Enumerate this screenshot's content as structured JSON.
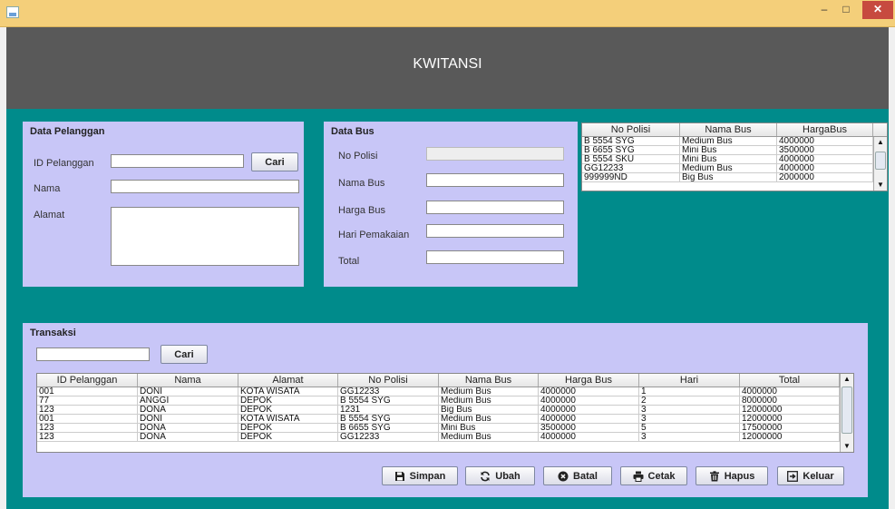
{
  "window": {
    "title": ""
  },
  "header": {
    "title": "KWITANSI"
  },
  "pelanggan": {
    "title": "Data Pelanggan",
    "id_label": "ID Pelanggan",
    "nama_label": "Nama",
    "alamat_label": "Alamat",
    "cari_label": "Cari"
  },
  "bus": {
    "title": "Data Bus",
    "nopol_label": "No Polisi",
    "nama_label": "Nama Bus",
    "harga_label": "Harga Bus",
    "hari_label": "Hari Pemakaian",
    "total_label": "Total"
  },
  "bus_table": {
    "headers": [
      "No Polisi",
      "Nama Bus",
      "HargaBus"
    ],
    "rows": [
      [
        "B 5554 SYG",
        "Medium Bus",
        "4000000"
      ],
      [
        "B 6655 SYG",
        "Mini Bus",
        "3500000"
      ],
      [
        "B 5554 SKU",
        "Mini Bus",
        "4000000"
      ],
      [
        "GG12233",
        "Medium Bus",
        "4000000"
      ],
      [
        "999999ND",
        "Big Bus",
        "2000000"
      ]
    ]
  },
  "transaksi": {
    "title": "Transaksi",
    "cari_label": "Cari",
    "headers": [
      "ID Pelanggan",
      "Nama",
      "Alamat",
      "No Polisi",
      "Nama Bus",
      "Harga Bus",
      "Hari",
      "Total"
    ],
    "rows": [
      [
        "001",
        "DONI",
        "KOTA WISATA",
        "GG12233",
        "Medium Bus",
        "4000000",
        "1",
        "4000000"
      ],
      [
        "77",
        "ANGGI",
        "DEPOK",
        "B 5554 SYG",
        "Medium Bus",
        "4000000",
        "2",
        "8000000"
      ],
      [
        "123",
        "DONA",
        "DEPOK",
        "1231",
        "Big Bus",
        "4000000",
        "3",
        "12000000"
      ],
      [
        "001",
        "DONI",
        "KOTA WISATA",
        "B 5554 SYG",
        "Medium Bus",
        "4000000",
        "3",
        "12000000"
      ],
      [
        "123",
        "DONA",
        "DEPOK",
        "B 6655 SYG",
        "Mini Bus",
        "3500000",
        "5",
        "17500000"
      ],
      [
        "123",
        "DONA",
        "DEPOK",
        "GG12233",
        "Medium Bus",
        "4000000",
        "3",
        "12000000"
      ]
    ]
  },
  "actions": {
    "simpan": "Simpan",
    "ubah": "Ubah",
    "batal": "Batal",
    "cetak": "Cetak",
    "hapus": "Hapus",
    "keluar": "Keluar"
  },
  "icons": {
    "app": "java-app-icon",
    "simpan": "floppy-disk-icon",
    "ubah": "refresh-icon",
    "batal": "cancel-circle-icon",
    "cetak": "printer-icon",
    "hapus": "trash-icon",
    "keluar": "exit-icon"
  },
  "colors": {
    "background": "#008b8b",
    "header": "#595959",
    "panel": "#c8c6f7",
    "titlebar": "#f4cf7a",
    "close": "#c74a3f"
  }
}
